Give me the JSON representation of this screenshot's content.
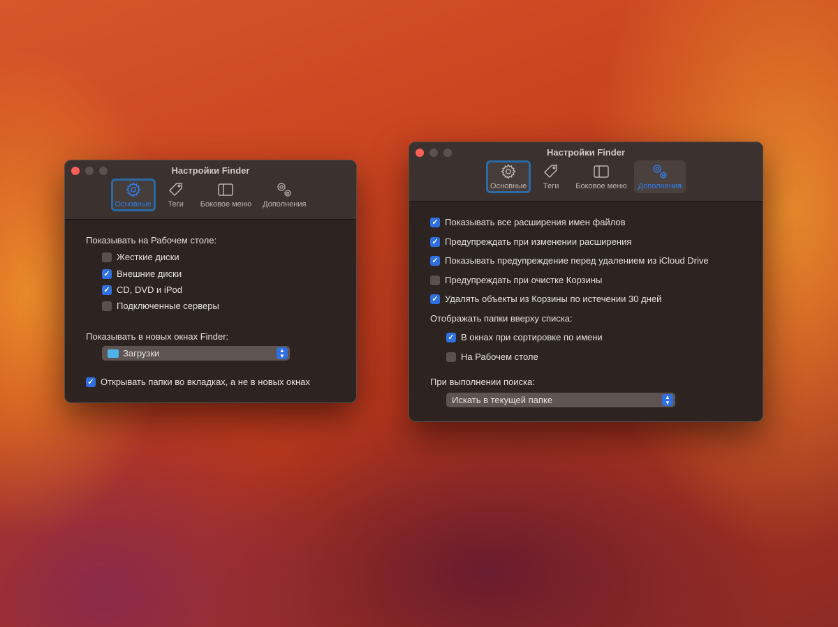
{
  "left_window": {
    "title": "Настройки Finder",
    "tabs": [
      "Основные",
      "Теги",
      "Боковое меню",
      "Дополнения"
    ],
    "desktop_heading": "Показывать на Рабочем столе:",
    "desktop_items": [
      {
        "label": "Жесткие диски",
        "checked": false
      },
      {
        "label": "Внешние диски",
        "checked": true
      },
      {
        "label": "CD, DVD и iPod",
        "checked": true
      },
      {
        "label": "Подключенные серверы",
        "checked": false
      }
    ],
    "new_window_heading": "Показывать в новых окнах Finder:",
    "new_window_value": "Загрузки",
    "tabs_option": {
      "label": "Открывать папки во вкладках, а не в новых окнах",
      "checked": true
    }
  },
  "right_window": {
    "title": "Настройки Finder",
    "tabs": [
      "Основные",
      "Теги",
      "Боковое меню",
      "Дополнения"
    ],
    "options": [
      {
        "label": "Показывать все расширения имен файлов",
        "checked": true
      },
      {
        "label": "Предупреждать при изменении расширения",
        "checked": true
      },
      {
        "label": "Показывать предупреждение перед удалением из iCloud Drive",
        "checked": true
      },
      {
        "label": "Предупреждать при очистке Корзины",
        "checked": false
      },
      {
        "label": "Удалять объекты из Корзины по истечении 30 дней",
        "checked": true
      }
    ],
    "folders_heading": "Отображать папки вверху списка:",
    "folders_options": [
      {
        "label": "В окнах при сортировке по имени",
        "checked": true
      },
      {
        "label": "На Рабочем столе",
        "checked": false
      }
    ],
    "search_heading": "При выполнении поиска:",
    "search_value": "Искать в текущей папке"
  },
  "colors": {
    "accent": "#2f6fe0",
    "window": "#2d2422"
  }
}
